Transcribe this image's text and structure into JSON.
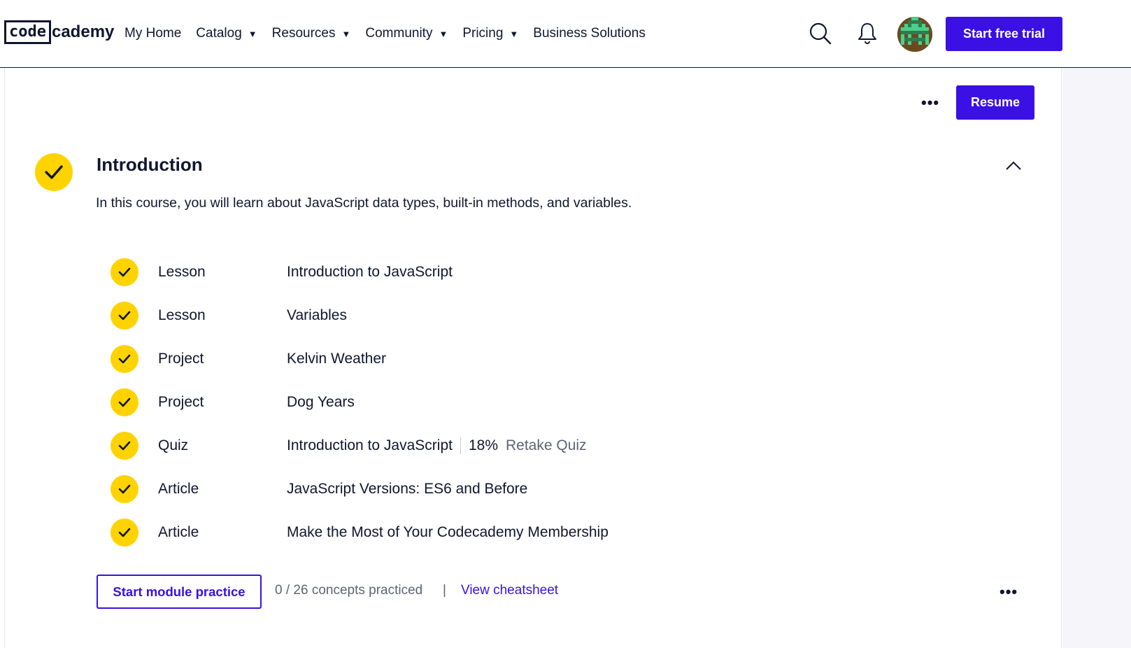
{
  "header": {
    "logo": {
      "part1": "code",
      "part2": "cademy"
    },
    "nav": [
      {
        "label": "My Home",
        "dropdown": false
      },
      {
        "label": "Catalog",
        "dropdown": true
      },
      {
        "label": "Resources",
        "dropdown": true
      },
      {
        "label": "Community",
        "dropdown": true
      },
      {
        "label": "Pricing",
        "dropdown": true
      },
      {
        "label": "Business Solutions",
        "dropdown": false
      }
    ],
    "icons": {
      "search": "search-icon",
      "notifications": "bell-icon"
    },
    "cta_label": "Start free trial"
  },
  "toolbar": {
    "more_glyph": "•••",
    "resume_label": "Resume"
  },
  "module": {
    "title": "Introduction",
    "description": "In this course, you will learn about JavaScript data types, built-in methods, and variables.",
    "items": [
      {
        "type": "Lesson",
        "name": "Introduction to JavaScript",
        "completed": true
      },
      {
        "type": "Lesson",
        "name": "Variables",
        "completed": true
      },
      {
        "type": "Project",
        "name": "Kelvin Weather",
        "completed": true
      },
      {
        "type": "Project",
        "name": "Dog Years",
        "completed": true
      },
      {
        "type": "Quiz",
        "name": "Introduction to JavaScript",
        "completed": true,
        "score": "18%",
        "action": "Retake Quiz"
      },
      {
        "type": "Article",
        "name": "JavaScript Versions: ES6 and Before",
        "completed": true
      },
      {
        "type": "Article",
        "name": "Make the Most of Your Codecademy Membership",
        "completed": true
      }
    ],
    "practice_label": "Start module practice",
    "concepts_text": "0 / 26 concepts practiced",
    "separator": "|",
    "cheatsheet_label": "View cheatsheet",
    "footer_more_glyph": "•••"
  },
  "colors": {
    "primary": "#3a10e5",
    "check": "#ffd300",
    "text": "#10162f",
    "muted": "#5f6373"
  }
}
